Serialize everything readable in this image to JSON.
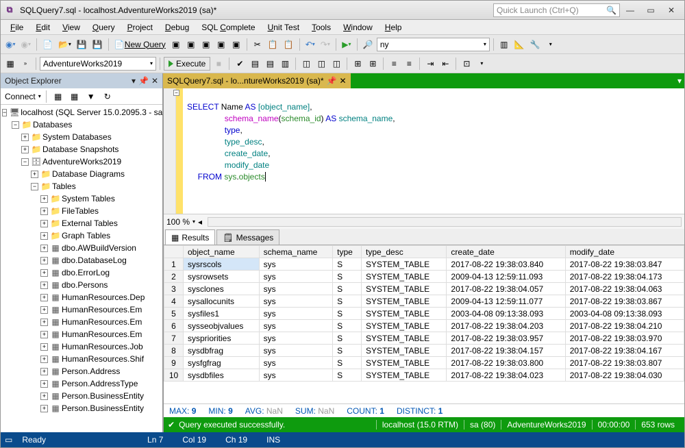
{
  "title": "SQLQuery7.sql - localhost.AdventureWorks2019 (sa)*",
  "quick_launch": "Quick Launch (Ctrl+Q)",
  "menu": {
    "file": "File",
    "edit": "Edit",
    "view": "View",
    "query": "Query",
    "project": "Project",
    "debug": "Debug",
    "sqlcomplete": "SQL Complete",
    "unittest": "Unit Test",
    "tools": "Tools",
    "window": "Window",
    "help": "Help"
  },
  "toolbar": {
    "newquery": "New Query",
    "find_value": "ny"
  },
  "toolbar2": {
    "db": "AdventureWorks2019",
    "execute": "Execute"
  },
  "objexp": {
    "title": "Object Explorer",
    "connect": "Connect",
    "server": "localhost (SQL Server 15.0.2095.3 - sa",
    "databases": "Databases",
    "sysdb": "System Databases",
    "snapshots": "Database Snapshots",
    "aw": "AdventureWorks2019",
    "diagrams": "Database Diagrams",
    "tables": "Tables",
    "systables": "System Tables",
    "filetables": "FileTables",
    "external": "External Tables",
    "graph": "Graph Tables",
    "t1": "dbo.AWBuildVersion",
    "t2": "dbo.DatabaseLog",
    "t3": "dbo.ErrorLog",
    "t4": "dbo.Persons",
    "t5": "HumanResources.Dep",
    "t6": "HumanResources.Em",
    "t7": "HumanResources.Em",
    "t8": "HumanResources.Em",
    "t9": "HumanResources.Job",
    "t10": "HumanResources.Shif",
    "t11": "Person.Address",
    "t12": "Person.AddressType",
    "t13": "Person.BusinessEntity",
    "t14": "Person.BusinessEntity"
  },
  "doc_tab": "SQLQuery7.sql - lo...ntureWorks2019 (sa)*",
  "sql": {
    "l1a": "SELECT",
    "l1b": " Name ",
    "l1c": "AS",
    "l1d": " [object_name]",
    "l2a": "schema_name",
    "l2b": "(",
    "l2c": "schema_id",
    "l2d": ") ",
    "l2e": "AS",
    "l2f": " schema_name",
    "l3": "type",
    "l4": "type_desc",
    "l5": "create_date",
    "l6": "modify_date",
    "l7a": "FROM",
    "l7b": " sys",
    "l7c": ".",
    "l7d": "objects"
  },
  "zoom": "100 %",
  "results_tabs": {
    "results": "Results",
    "messages": "Messages"
  },
  "cols": {
    "c0": "object_name",
    "c1": "schema_name",
    "c2": "type",
    "c3": "type_desc",
    "c4": "create_date",
    "c5": "modify_date"
  },
  "rows": [
    {
      "n": "1",
      "c0": "sysrscols",
      "c1": "sys",
      "c2": "S",
      "c3": "SYSTEM_TABLE",
      "c4": "2017-08-22 19:38:03.840",
      "c5": "2017-08-22 19:38:03.847"
    },
    {
      "n": "2",
      "c0": "sysrowsets",
      "c1": "sys",
      "c2": "S",
      "c3": "SYSTEM_TABLE",
      "c4": "2009-04-13 12:59:11.093",
      "c5": "2017-08-22 19:38:04.173"
    },
    {
      "n": "3",
      "c0": "sysclones",
      "c1": "sys",
      "c2": "S",
      "c3": "SYSTEM_TABLE",
      "c4": "2017-08-22 19:38:04.057",
      "c5": "2017-08-22 19:38:04.063"
    },
    {
      "n": "4",
      "c0": "sysallocunits",
      "c1": "sys",
      "c2": "S",
      "c3": "SYSTEM_TABLE",
      "c4": "2009-04-13 12:59:11.077",
      "c5": "2017-08-22 19:38:03.867"
    },
    {
      "n": "5",
      "c0": "sysfiles1",
      "c1": "sys",
      "c2": "S",
      "c3": "SYSTEM_TABLE",
      "c4": "2003-04-08 09:13:38.093",
      "c5": "2003-04-08 09:13:38.093"
    },
    {
      "n": "6",
      "c0": "sysseobjvalues",
      "c1": "sys",
      "c2": "S",
      "c3": "SYSTEM_TABLE",
      "c4": "2017-08-22 19:38:04.203",
      "c5": "2017-08-22 19:38:04.210"
    },
    {
      "n": "7",
      "c0": "syspriorities",
      "c1": "sys",
      "c2": "S",
      "c3": "SYSTEM_TABLE",
      "c4": "2017-08-22 19:38:03.957",
      "c5": "2017-08-22 19:38:03.970"
    },
    {
      "n": "8",
      "c0": "sysdbfrag",
      "c1": "sys",
      "c2": "S",
      "c3": "SYSTEM_TABLE",
      "c4": "2017-08-22 19:38:04.157",
      "c5": "2017-08-22 19:38:04.167"
    },
    {
      "n": "9",
      "c0": "sysfgfrag",
      "c1": "sys",
      "c2": "S",
      "c3": "SYSTEM_TABLE",
      "c4": "2017-08-22 19:38:03.800",
      "c5": "2017-08-22 19:38:03.807"
    },
    {
      "n": "10",
      "c0": "sysdbfiles",
      "c1": "sys",
      "c2": "S",
      "c3": "SYSTEM_TABLE",
      "c4": "2017-08-22 19:38:04.023",
      "c5": "2017-08-22 19:38:04.030"
    }
  ],
  "stats": {
    "max": "MAX:",
    "maxv": "9",
    "min": "MIN:",
    "minv": "9",
    "avg": "AVG:",
    "avgv": "NaN",
    "sum": "SUM:",
    "sumv": "NaN",
    "count": "COUNT:",
    "countv": "1",
    "distinct": "DISTINCT:",
    "distinctv": "1"
  },
  "querystatus": {
    "ok": "Query executed successfully.",
    "server": "localhost (15.0 RTM)",
    "user": "sa (80)",
    "db": "AdventureWorks2019",
    "time": "00:00:00",
    "rows": "653 rows"
  },
  "statusbar": {
    "ready": "Ready",
    "ln": "Ln 7",
    "col": "Col 19",
    "ch": "Ch 19",
    "ins": "INS"
  }
}
